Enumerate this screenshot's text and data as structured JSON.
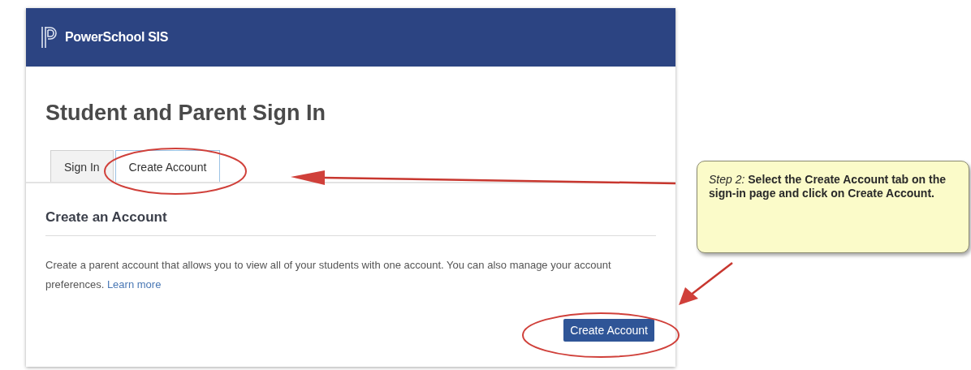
{
  "header": {
    "title": "PowerSchool SIS"
  },
  "page_title": "Student and Parent Sign In",
  "tabs": [
    {
      "label": "Sign In",
      "selected": false
    },
    {
      "label": "Create Account",
      "selected": true
    }
  ],
  "section": {
    "heading": "Create an Account",
    "text": "Create a parent account that allows you to view all of your students with one account. You can also manage your account preferences.",
    "link": "Learn more",
    "button": "Create Account"
  },
  "callout": {
    "text": "*Step 2:*  **Select the Create Account tab on the sign-in page and click on Create Account.**"
  }
}
